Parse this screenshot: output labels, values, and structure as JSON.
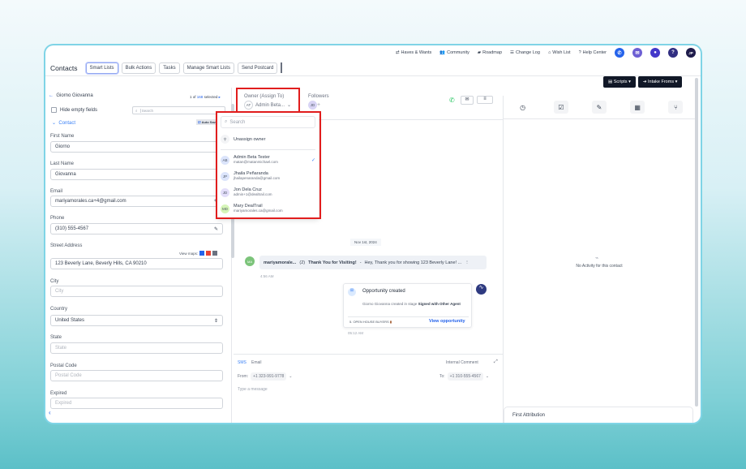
{
  "topnav": {
    "links": [
      "Haves & Wants",
      "Community",
      "Roadmap",
      "Change Log",
      "Wish List",
      "Help Center"
    ],
    "avatar": "JP"
  },
  "header": {
    "title": "Contacts",
    "tabs": [
      "Smart Lists",
      "Bulk Actions",
      "Tasks",
      "Manage Smart Lists",
      "Send Postcard"
    ]
  },
  "contact": {
    "name": "Giorno Giovanna",
    "position_prefix": "1 of",
    "total": "168",
    "position_suffix": "selected",
    "hide_empty": "Hide empty fields",
    "search_placeholder": "Search",
    "section": "Contact",
    "auto_save": "Auto Save"
  },
  "fields": {
    "first_name": {
      "label": "First Name",
      "value": "Giorno"
    },
    "last_name": {
      "label": "Last Name",
      "value": "Giovanna"
    },
    "email": {
      "label": "Email",
      "value": "mariyamorales.ca+4@gmail.com"
    },
    "phone": {
      "label": "Phone",
      "value": "(310) 555-4567"
    },
    "street": {
      "label": "Street Address",
      "value": "123 Beverly Lane, Beverly Hills, CA 90210",
      "view_maps": "View maps:"
    },
    "city": {
      "label": "City",
      "placeholder": "City"
    },
    "country": {
      "label": "Country",
      "value": "United States"
    },
    "state": {
      "label": "State",
      "placeholder": "State"
    },
    "postal": {
      "label": "Postal Code",
      "placeholder": "Postal Code"
    },
    "expired": {
      "label": "Expired",
      "placeholder": "Expired"
    }
  },
  "owner": {
    "label": "Owner (Assign To)",
    "initials": "AT",
    "value": "Admin Beta...",
    "followers_label": "Followers",
    "follower_initials": "JD"
  },
  "dropdown": {
    "search_placeholder": "Search",
    "unassign": "Unassign owner",
    "users": [
      {
        "initials": "AB",
        "name": "Admin Beta Tester",
        "email": "matan@matanmichael.com",
        "selected": true,
        "color": "#dbe4fb"
      },
      {
        "initials": "JP",
        "name": "Jhaila Peñaranda",
        "email": "jhailapenaranda@gmail.com",
        "selected": false,
        "color": "#dbe4fb"
      },
      {
        "initials": "JD",
        "name": "Jon Dela Cruz",
        "email": "admin+1@dealtrail.com",
        "selected": false,
        "color": "#e3defa"
      },
      {
        "initials": "MD",
        "name": "Mary DealTrail",
        "email": "mariyamorales.ca@gmail.com",
        "selected": false,
        "color": "#d6f5b8"
      }
    ]
  },
  "conversation": {
    "date": "Nov 1st, 2024",
    "msg_avatar": "MA",
    "msg_sender": "mariyamorale...",
    "msg_count": "(2)",
    "msg_subject": "Thank You for Visiting!",
    "msg_sep": "-",
    "msg_preview": "Hey,  Thank you for showing 123 Beverly Lane! ...",
    "msg_time": "4:56 AM",
    "opp_title": "Opportunity created",
    "opp_text": "Giorno Giovanna created in stage",
    "opp_stage": "Signed with Other Agent",
    "opp_pipeline": "5. OPEN HOUSE BUYERS",
    "opp_link": "View opportunity",
    "opp_time": "05:12 AM"
  },
  "composer": {
    "tabs": [
      "SMS",
      "Email"
    ],
    "internal": "Internal Comment",
    "from_label": "From:",
    "from": "+1 323-991-9778",
    "to_label": "To:",
    "to": "+1 310-555-4567",
    "placeholder": "Type a message"
  },
  "right": {
    "scripts": "Scripts",
    "intake": "Intake Froms",
    "empty": "No Activity for this contact",
    "attribution": "First Attribution"
  }
}
